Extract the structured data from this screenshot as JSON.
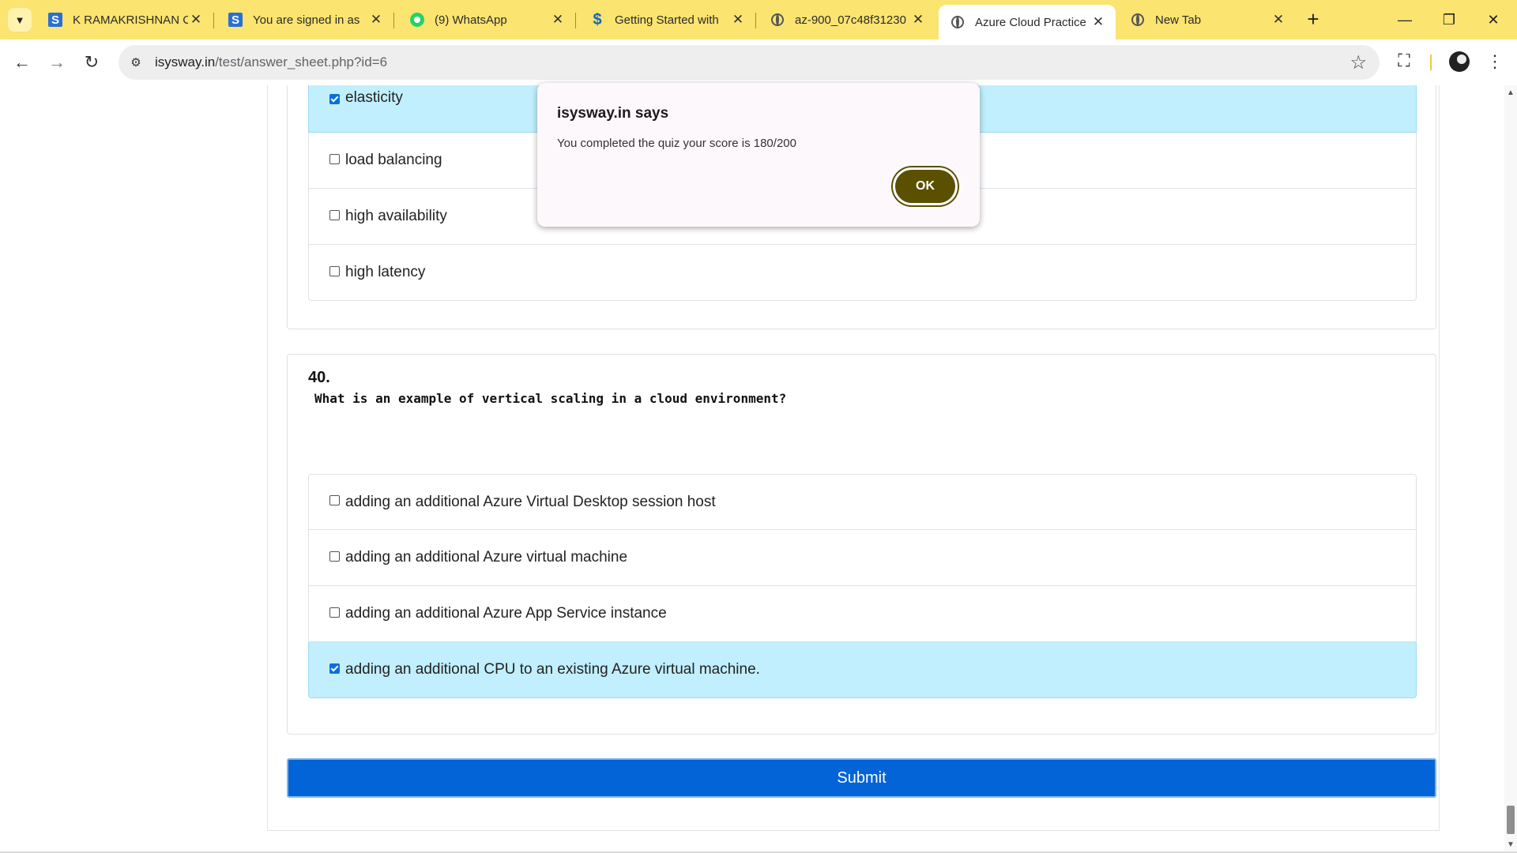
{
  "browser": {
    "tab_search_icon": "chevron-down-icon",
    "tabs": [
      {
        "title": "K RAMAKRISHNAN C",
        "favicon": "s-logo-icon"
      },
      {
        "title": "You are signed in as",
        "favicon": "s-logo-icon"
      },
      {
        "title": "(9) WhatsApp",
        "favicon": "whatsapp-icon"
      },
      {
        "title": "Getting Started with",
        "favicon": "s-dollar-icon"
      },
      {
        "title": "az-900_07c48f31230",
        "favicon": "globe-icon"
      },
      {
        "title": "Azure Cloud Practice",
        "favicon": "globe-icon"
      },
      {
        "title": "New Tab",
        "favicon": "globe-icon"
      }
    ],
    "active_tab_index": 5,
    "url_host": "isysway.in",
    "url_path": "/test/answer_sheet.php?id=6",
    "tab_strip_color": "#fbe470"
  },
  "quiz": {
    "prev_question": {
      "options": [
        {
          "text": "elasticity",
          "checked": true
        },
        {
          "text": "load balancing",
          "checked": false
        },
        {
          "text": "high availability",
          "checked": false
        },
        {
          "text": "high latency",
          "checked": false
        }
      ]
    },
    "question": {
      "number": "40.",
      "text": "What is an example of vertical scaling in a cloud environment?",
      "options": [
        {
          "text": "adding an additional Azure Virtual Desktop session host",
          "checked": false
        },
        {
          "text": "adding an additional Azure virtual machine",
          "checked": false
        },
        {
          "text": "adding an additional Azure App Service instance",
          "checked": false
        },
        {
          "text": "adding an additional CPU to an existing Azure virtual machine.",
          "checked": true
        }
      ]
    },
    "submit_label": "Submit",
    "selected_color": "#c1effd",
    "submit_color": "#0264d6"
  },
  "dialog": {
    "title": "isysway.in says",
    "message": "You completed the quiz your score is 180/200",
    "ok_label": "OK"
  }
}
